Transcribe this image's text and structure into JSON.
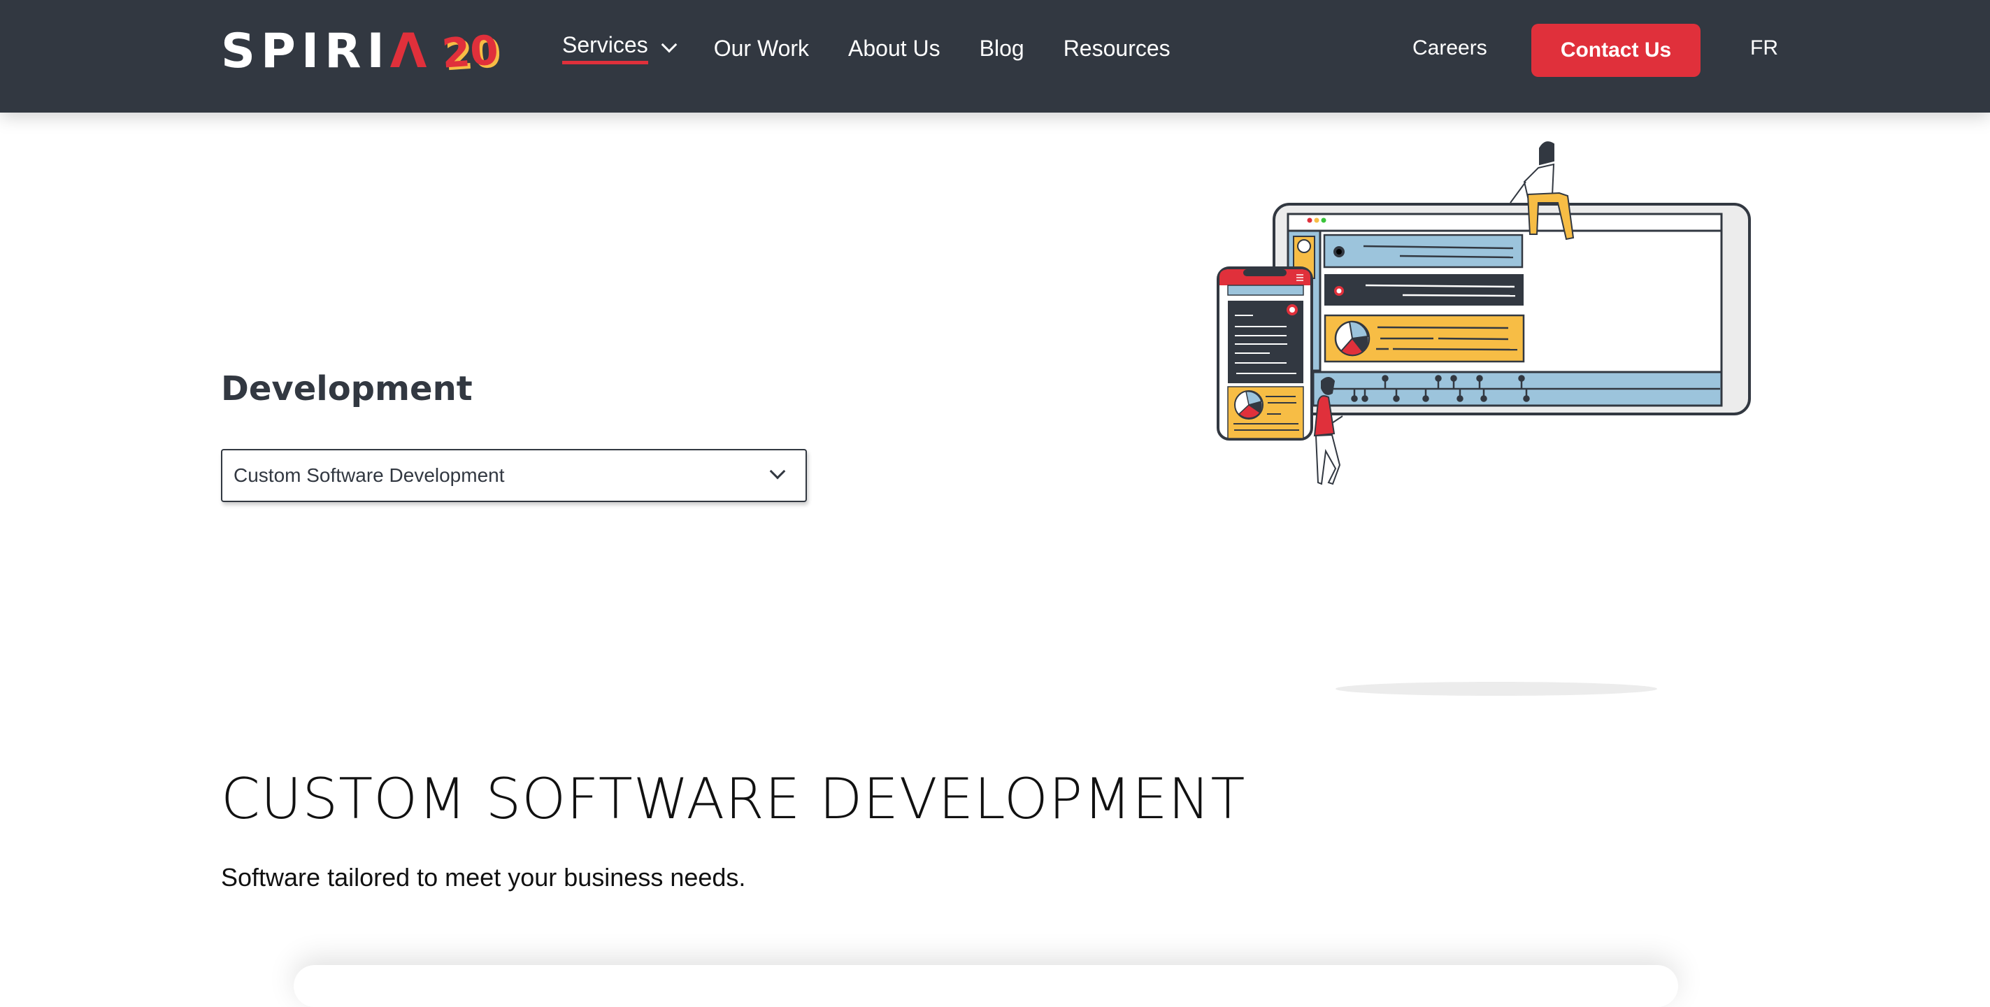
{
  "header": {
    "logo": {
      "brand": "SPIRI",
      "brand_accent": "Λ",
      "anniversary": "20"
    },
    "nav": [
      {
        "label": "Services",
        "has_dropdown": true,
        "active": true
      },
      {
        "label": "Our Work"
      },
      {
        "label": "About Us"
      },
      {
        "label": "Blog"
      },
      {
        "label": "Resources"
      }
    ],
    "careers": "Careers",
    "contact_button": "Contact Us",
    "language": "FR"
  },
  "main": {
    "section_title": "Development",
    "service_select": {
      "value": "Custom Software Development"
    },
    "page_title": "CUSTOM SOFTWARE DEVELOPMENT",
    "subtitle": "Software tailored to meet your business needs."
  },
  "colors": {
    "header_bg": "#323841",
    "accent_red": "#e0303b",
    "accent_yellow": "#f7bd45",
    "accent_blue": "#9cc4dc"
  }
}
